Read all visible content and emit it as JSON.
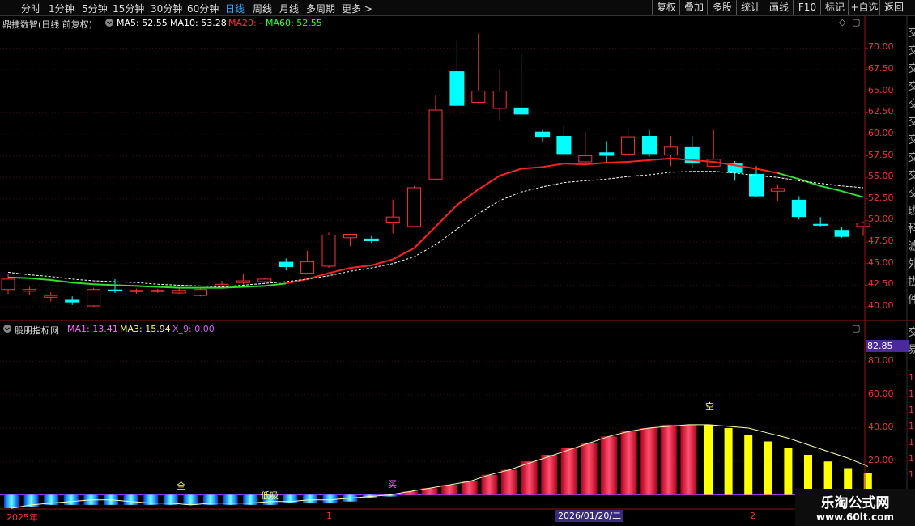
{
  "topbar": {
    "periods": [
      "分时",
      "1分钟",
      "5分钟",
      "15分钟",
      "30分钟",
      "60分钟",
      "日线",
      "周线",
      "月线",
      "多周期",
      "更多"
    ],
    "active_period": "日线",
    "tools": [
      "复权",
      "叠加",
      "多股",
      "统计",
      "画线",
      "F10",
      "标记",
      "+自选",
      "返回"
    ]
  },
  "main_panel": {
    "title": "鼎捷数智(日线 前复权)",
    "ma5_label": "MA5: 52.55",
    "ma10_label": "MA10: 53.28",
    "ma20_label": "MA20: -",
    "ma60_label": "MA60: 52.55",
    "colors": {
      "ma5": "#ffffff",
      "ma10": "#ffffff",
      "ma20": "#ff2020",
      "ma60": "#33ff33",
      "up": "#ff3333",
      "down": "#00ffff"
    },
    "side_text": "交易时间",
    "side_chars": [
      "交",
      "交",
      "交",
      "交",
      "交",
      "交",
      "交",
      "交",
      "交",
      "交",
      "珑",
      "科",
      "滤",
      "外",
      "拢",
      "件"
    ]
  },
  "price_axis": [
    "70.00",
    "67.50",
    "65.00",
    "62.50",
    "60.00",
    "57.50",
    "55.00",
    "52.50",
    "50.00",
    "47.50",
    "45.00",
    "42.50",
    "40.00"
  ],
  "indicator_panel": {
    "title": "股朋指标网",
    "ma1_label": "MA1: 13.41",
    "ma3_label": "MA3: 15.94",
    "x9_label": "X_9: 0.00",
    "current_value": "82.85",
    "axis": [
      "80.00",
      "60.00",
      "40.00",
      "20.00",
      "0.00"
    ],
    "axis_prefix": "1",
    "signals": {
      "full": "全",
      "low_buy": "低吸",
      "buy": "买",
      "empty": "空"
    },
    "side_chars": [
      "交",
      "易"
    ]
  },
  "time_axis": {
    "labels": [
      "2025年",
      "1",
      "2"
    ],
    "cursor_date": "2026/01/20/二"
  },
  "watermark": {
    "line1": "乐淘公式网",
    "line2": "www.60lt.com"
  },
  "chart_data": {
    "type": "candlestick",
    "price_range": [
      38.5,
      72.0
    ],
    "candles": [
      {
        "o": 42.0,
        "h": 43.8,
        "l": 41.5,
        "c": 43.2
      },
      {
        "o": 41.8,
        "h": 42.3,
        "l": 41.4,
        "c": 42.0
      },
      {
        "o": 41.1,
        "h": 41.7,
        "l": 40.6,
        "c": 41.3
      },
      {
        "o": 40.8,
        "h": 41.2,
        "l": 40.2,
        "c": 40.5
      },
      {
        "o": 40.1,
        "h": 42.2,
        "l": 40.0,
        "c": 42.0
      },
      {
        "o": 42.0,
        "h": 43.2,
        "l": 41.6,
        "c": 41.9
      },
      {
        "o": 41.8,
        "h": 42.1,
        "l": 41.5,
        "c": 41.9
      },
      {
        "o": 41.8,
        "h": 42.1,
        "l": 41.6,
        "c": 41.9
      },
      {
        "o": 41.6,
        "h": 42.2,
        "l": 41.5,
        "c": 41.9
      },
      {
        "o": 41.3,
        "h": 42.3,
        "l": 41.2,
        "c": 42.0
      },
      {
        "o": 42.4,
        "h": 43.0,
        "l": 42.1,
        "c": 42.6
      },
      {
        "o": 42.8,
        "h": 43.8,
        "l": 42.6,
        "c": 43.0
      },
      {
        "o": 42.9,
        "h": 43.4,
        "l": 42.7,
        "c": 43.2
      },
      {
        "o": 45.2,
        "h": 45.6,
        "l": 44.2,
        "c": 44.6
      },
      {
        "o": 43.9,
        "h": 46.5,
        "l": 43.8,
        "c": 45.2
      },
      {
        "o": 44.7,
        "h": 48.6,
        "l": 44.5,
        "c": 48.3
      },
      {
        "o": 48.0,
        "h": 48.4,
        "l": 47.0,
        "c": 48.4
      },
      {
        "o": 47.9,
        "h": 48.2,
        "l": 47.4,
        "c": 47.6
      },
      {
        "o": 49.8,
        "h": 52.4,
        "l": 48.5,
        "c": 50.4
      },
      {
        "o": 49.3,
        "h": 54.0,
        "l": 49.2,
        "c": 53.8
      },
      {
        "o": 54.8,
        "h": 64.5,
        "l": 54.6,
        "c": 62.8
      },
      {
        "o": 67.3,
        "h": 70.8,
        "l": 63.1,
        "c": 63.3
      },
      {
        "o": 63.7,
        "h": 71.7,
        "l": 63.6,
        "c": 65.0
      },
      {
        "o": 63.0,
        "h": 67.4,
        "l": 61.6,
        "c": 65.0
      },
      {
        "o": 63.1,
        "h": 69.5,
        "l": 62.1,
        "c": 62.3
      },
      {
        "o": 60.3,
        "h": 60.5,
        "l": 59.1,
        "c": 59.7
      },
      {
        "o": 59.8,
        "h": 61.0,
        "l": 57.4,
        "c": 57.7
      },
      {
        "o": 56.8,
        "h": 60.3,
        "l": 56.6,
        "c": 57.5
      },
      {
        "o": 57.9,
        "h": 59.2,
        "l": 56.6,
        "c": 57.5
      },
      {
        "o": 57.7,
        "h": 60.7,
        "l": 57.3,
        "c": 59.7
      },
      {
        "o": 59.8,
        "h": 60.5,
        "l": 57.4,
        "c": 57.7
      },
      {
        "o": 57.6,
        "h": 59.8,
        "l": 56.3,
        "c": 58.5
      },
      {
        "o": 58.5,
        "h": 59.8,
        "l": 56.1,
        "c": 56.6
      },
      {
        "o": 56.3,
        "h": 60.5,
        "l": 56.2,
        "c": 57.1
      },
      {
        "o": 56.6,
        "h": 56.9,
        "l": 54.6,
        "c": 55.5
      },
      {
        "o": 55.4,
        "h": 56.3,
        "l": 52.7,
        "c": 52.8
      },
      {
        "o": 53.4,
        "h": 54.2,
        "l": 52.3,
        "c": 53.7
      },
      {
        "o": 52.4,
        "h": 52.8,
        "l": 50.1,
        "c": 50.4
      },
      {
        "o": 49.6,
        "h": 50.4,
        "l": 49.3,
        "c": 49.4
      },
      {
        "o": 48.9,
        "h": 49.3,
        "l": 48.0,
        "c": 48.1
      },
      {
        "o": 49.3,
        "h": 49.9,
        "l": 48.2,
        "c": 49.7
      }
    ],
    "ma20": [
      43.4,
      43.3,
      43.1,
      42.8,
      42.6,
      42.5,
      42.4,
      42.3,
      42.2,
      42.2,
      42.2,
      42.3,
      42.4,
      42.7,
      43.2,
      43.9,
      44.5,
      44.8,
      45.5,
      46.8,
      49.3,
      51.8,
      53.6,
      55.2,
      56.0,
      56.2,
      56.6,
      56.5,
      56.7,
      56.8,
      57.0,
      57.2,
      57.0,
      56.8,
      56.4,
      56.0,
      55.5,
      54.8,
      54.0,
      53.4,
      52.7
    ],
    "ma60": [
      44.0,
      43.7,
      43.5,
      43.2,
      43.0,
      42.9,
      42.8,
      42.6,
      42.5,
      42.4,
      42.3,
      42.5,
      42.7,
      42.9,
      43.2,
      43.6,
      44.1,
      44.5,
      45.0,
      45.8,
      47.2,
      49.0,
      50.8,
      52.3,
      53.3,
      53.9,
      54.4,
      54.6,
      54.8,
      55.1,
      55.3,
      55.6,
      55.7,
      55.7,
      55.5,
      55.2,
      55.0,
      54.6,
      54.3,
      54.0,
      53.8
    ],
    "indicator": {
      "range": [
        -8,
        88
      ],
      "bars": [
        -8,
        -7,
        -6,
        -6,
        -6,
        -6,
        -6,
        -6,
        -6,
        -6,
        -6,
        -6,
        -6,
        -6,
        -5,
        -5,
        -5,
        -4,
        -2,
        -1,
        2,
        4,
        6,
        8,
        12,
        15,
        20,
        24,
        28,
        31,
        35,
        38,
        40,
        42,
        42,
        42,
        40,
        36,
        32,
        28,
        24,
        20,
        16,
        13
      ],
      "line": [
        -8,
        -6,
        -5,
        -4,
        -3,
        -3,
        -4,
        -5,
        -5,
        -6,
        -5,
        -5,
        -5,
        -4,
        -4,
        -3,
        -3,
        -2,
        -1,
        0,
        2,
        4,
        6,
        8,
        12,
        15,
        19,
        23,
        27,
        31,
        35,
        38,
        40,
        41,
        42,
        42,
        41,
        40,
        37,
        34,
        30,
        26,
        22,
        17
      ],
      "colors": {
        "low": "#00ccff",
        "rise": "#ff1040",
        "fall": "#ffff00",
        "line": "#ffffaa"
      }
    }
  }
}
